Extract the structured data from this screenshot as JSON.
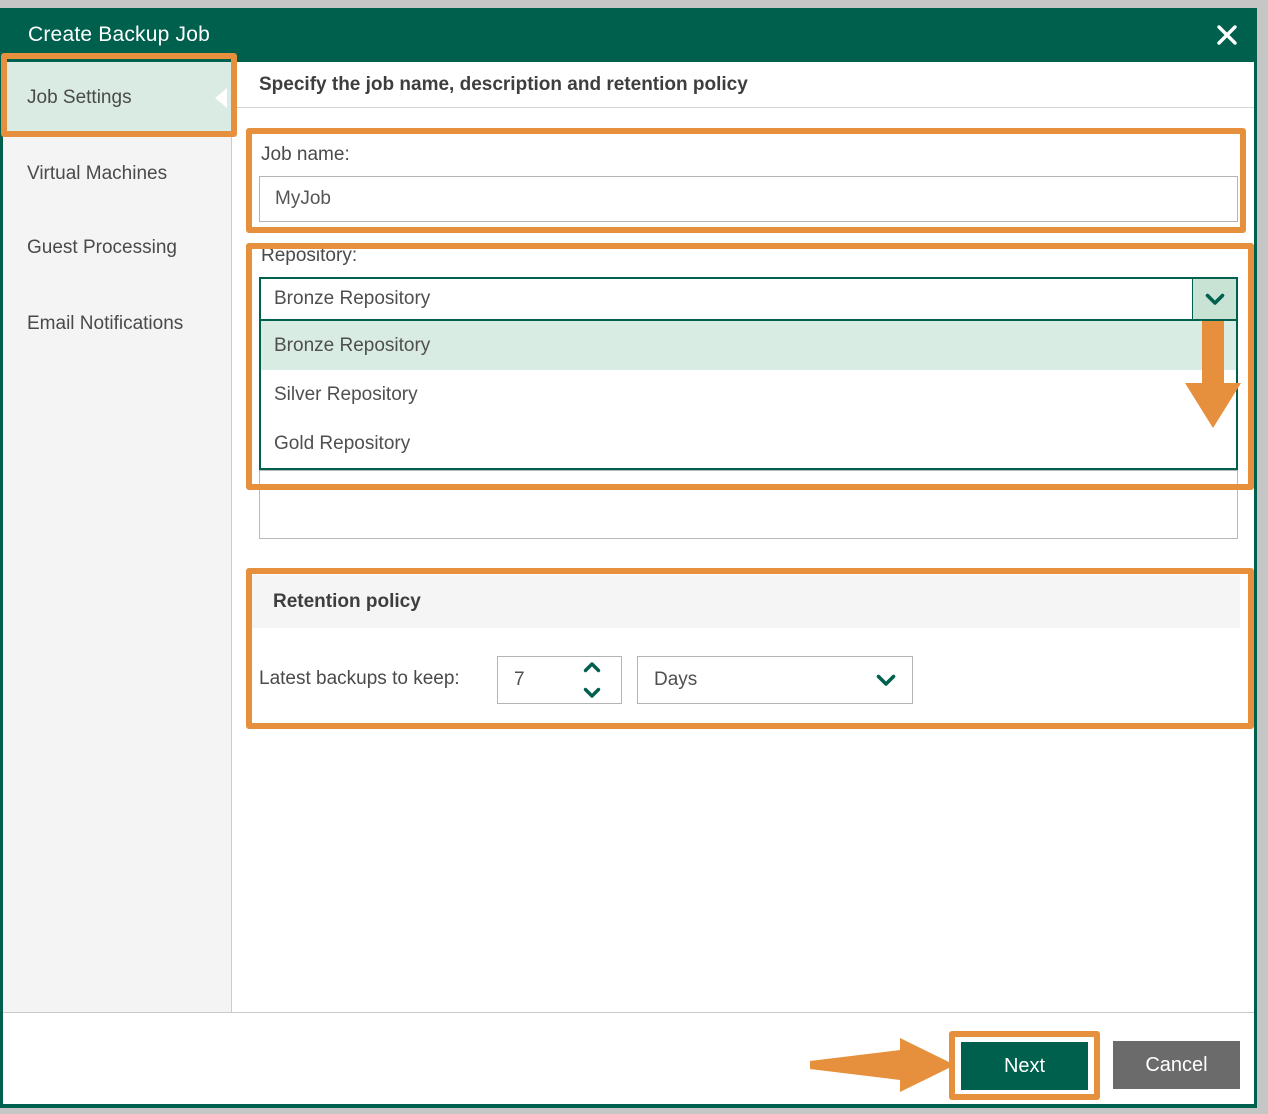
{
  "window": {
    "title": "Create Backup Job",
    "close": "close"
  },
  "sidebar": {
    "items": [
      {
        "label": "Job Settings",
        "active": true
      },
      {
        "label": "Virtual Machines",
        "active": false
      },
      {
        "label": "Guest Processing",
        "active": false
      },
      {
        "label": "Email Notifications",
        "active": false
      }
    ]
  },
  "main": {
    "heading": "Specify the job name, description and retention policy",
    "job_name": {
      "label": "Job name:",
      "value": "MyJob"
    },
    "repository": {
      "label": "Repository:",
      "selected": "Bronze Repository",
      "options": [
        "Bronze Repository",
        "Silver Repository",
        "Gold Repository"
      ],
      "highlighted_option": "Bronze Repository"
    },
    "retention": {
      "section_title": "Retention policy",
      "keep_label": "Latest backups to keep:",
      "keep_value": "7",
      "unit_value": "Days"
    }
  },
  "footer": {
    "next_label": "Next",
    "cancel_label": "Cancel"
  },
  "colors": {
    "brand_green": "#00604e",
    "light_green": "#d9ece3",
    "caret_cell_green": "#c8e2d4",
    "annotation_orange": "#e68f3d",
    "cancel_gray": "#6b6b6b",
    "sidebar_gray": "#f4f4f4",
    "desktop_gray": "#c6c6c6"
  }
}
